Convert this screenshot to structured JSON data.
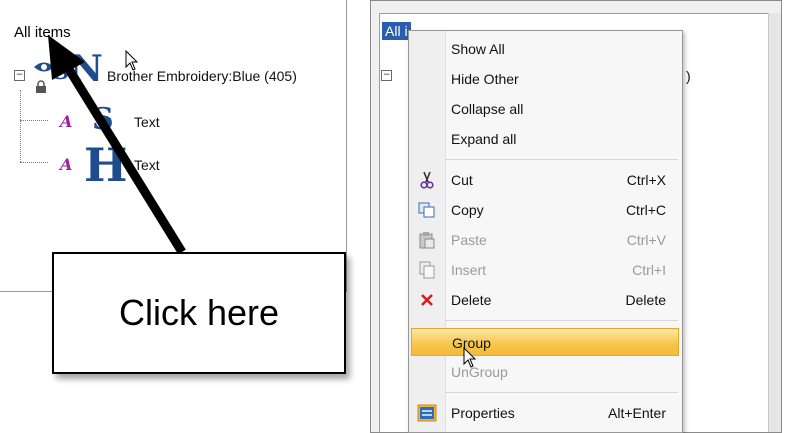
{
  "left_tree": {
    "root": "All items",
    "node_main": "Brother Embroidery:Blue (405)",
    "child_1": "Text",
    "child_2": "Text",
    "glyphs": {
      "n": "N",
      "s1": "S",
      "s2": "S",
      "h": "H",
      "a": "A"
    },
    "expander": "−"
  },
  "callout": {
    "text": "Click here"
  },
  "right_tree": {
    "root_visible": "All i",
    "fragment": ")"
  },
  "menu": {
    "items": [
      {
        "label": "Show All",
        "shortcut": ""
      },
      {
        "label": "Hide Other",
        "shortcut": ""
      },
      {
        "label": "Collapse all",
        "shortcut": ""
      },
      {
        "label": "Expand all",
        "shortcut": ""
      },
      {
        "label": "Cut",
        "shortcut": "Ctrl+X",
        "icon": "scissors-icon"
      },
      {
        "label": "Copy",
        "shortcut": "Ctrl+C",
        "icon": "copy-icon"
      },
      {
        "label": "Paste",
        "shortcut": "Ctrl+V",
        "icon": "paste-icon",
        "disabled": true
      },
      {
        "label": "Insert",
        "shortcut": "Ctrl+I",
        "icon": "insert-icon",
        "disabled": true
      },
      {
        "label": "Delete",
        "shortcut": "Delete",
        "icon": "delete-x-icon"
      },
      {
        "label": "Group",
        "shortcut": "",
        "highlighted": true
      },
      {
        "label": "UnGroup",
        "shortcut": "",
        "disabled": true
      },
      {
        "label": "Properties",
        "shortcut": "Alt+Enter",
        "icon": "properties-icon"
      }
    ]
  },
  "colors": {
    "selection_blue": "#2a5db0",
    "highlight_gold": "#f6c549",
    "embroidery_blue": "#1f4b8f",
    "text_icon_purple": "#a020a0",
    "delete_red": "#d02020"
  }
}
